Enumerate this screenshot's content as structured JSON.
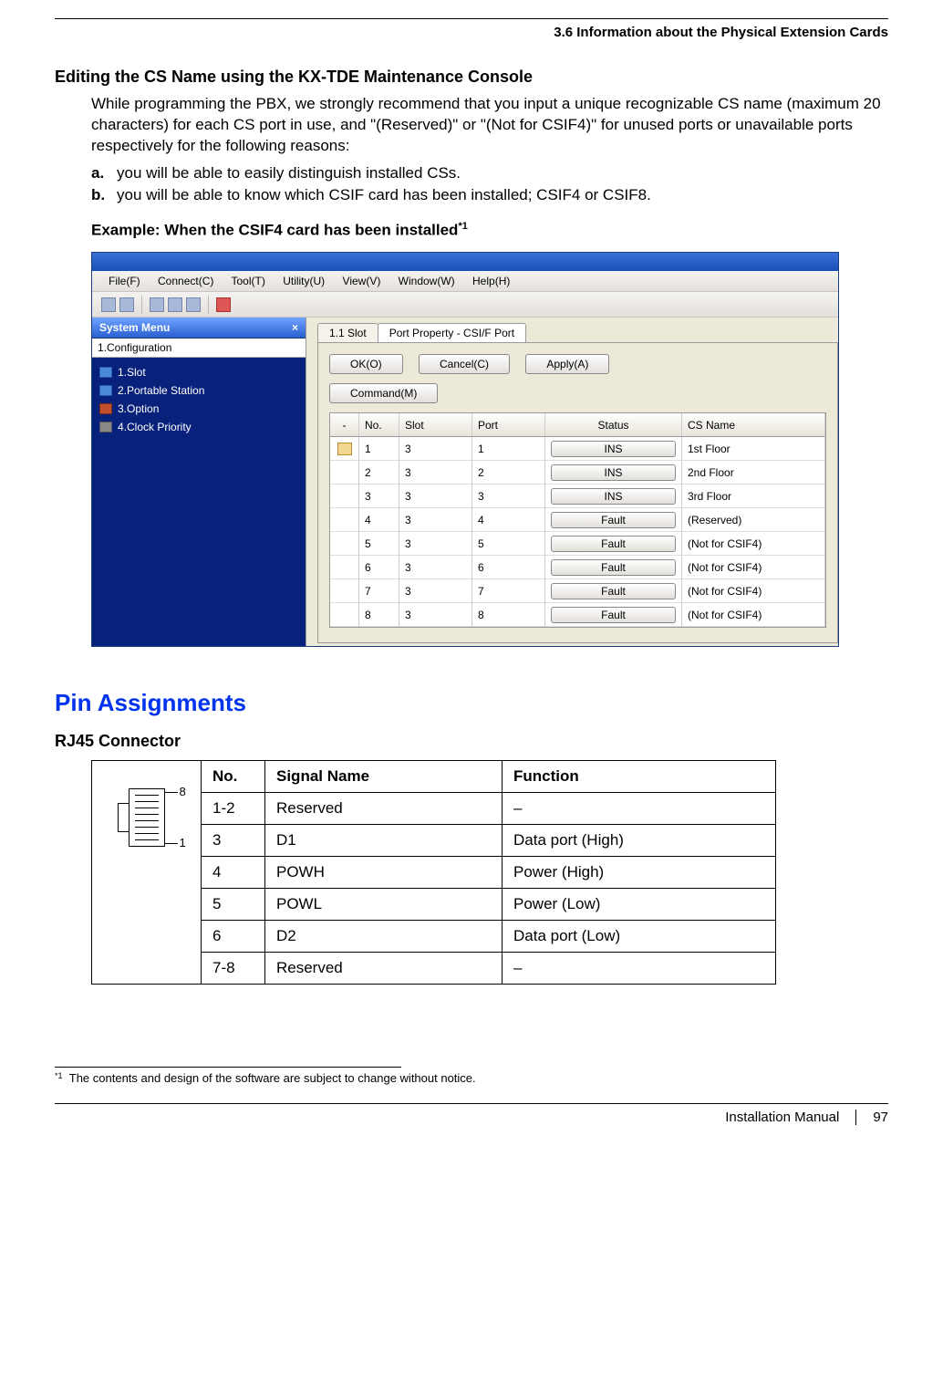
{
  "header": {
    "section": "3.6 Information about the Physical Extension Cards"
  },
  "editing": {
    "title": "Editing the CS Name using the KX-TDE Maintenance Console",
    "paragraph": "While programming the PBX, we strongly recommend that you input a unique recognizable CS name (maximum 20 characters) for each CS port in use, and \"(Reserved)\" or \"(Not for CSIF4)\" for unused ports or unavailable ports respectively for the following reasons:",
    "items": [
      "you will be able to easily distinguish installed CSs.",
      "you will be able to know which CSIF card has been installed; CSIF4 or CSIF8."
    ],
    "example_title": "Example: When the CSIF4 card has been installed",
    "example_sup": "*1"
  },
  "console": {
    "menus": [
      "File(F)",
      "Connect(C)",
      "Tool(T)",
      "Utility(U)",
      "View(V)",
      "Window(W)",
      "Help(H)"
    ],
    "side_title": "System Menu",
    "side_close": "×",
    "side_root": "1.Configuration",
    "tree": [
      {
        "label": "1.Slot",
        "cls": "blue"
      },
      {
        "label": "2.Portable Station",
        "cls": "blue"
      },
      {
        "label": "3.Option",
        "cls": "red"
      },
      {
        "label": "4.Clock Priority",
        "cls": "gray"
      }
    ],
    "tabs": [
      "1.1 Slot",
      "Port Property - CSI/F Port"
    ],
    "buttons": {
      "ok": "OK(O)",
      "cancel": "Cancel(C)",
      "apply": "Apply(A)",
      "command": "Command(M)"
    },
    "columns": {
      "flag": "-",
      "no": "No.",
      "slot": "Slot",
      "port": "Port",
      "status": "Status",
      "csname": "CS Name"
    },
    "rows": [
      {
        "no": "1",
        "slot": "3",
        "port": "1",
        "status": "INS",
        "csname": "1st Floor",
        "flag": true
      },
      {
        "no": "2",
        "slot": "3",
        "port": "2",
        "status": "INS",
        "csname": "2nd Floor"
      },
      {
        "no": "3",
        "slot": "3",
        "port": "3",
        "status": "INS",
        "csname": "3rd Floor"
      },
      {
        "no": "4",
        "slot": "3",
        "port": "4",
        "status": "Fault",
        "csname": "(Reserved)"
      },
      {
        "no": "5",
        "slot": "3",
        "port": "5",
        "status": "Fault",
        "csname": "(Not for CSIF4)"
      },
      {
        "no": "6",
        "slot": "3",
        "port": "6",
        "status": "Fault",
        "csname": "(Not for CSIF4)"
      },
      {
        "no": "7",
        "slot": "3",
        "port": "7",
        "status": "Fault",
        "csname": "(Not for CSIF4)"
      },
      {
        "no": "8",
        "slot": "3",
        "port": "8",
        "status": "Fault",
        "csname": "(Not for CSIF4)"
      }
    ]
  },
  "pin": {
    "heading": "Pin Assignments",
    "sub": "RJ45 Connector",
    "diagram": {
      "top": "8",
      "bottom": "1"
    },
    "columns": {
      "no": "No.",
      "sig": "Signal Name",
      "func": "Function"
    },
    "rows": [
      {
        "no": "1-2",
        "sig": "Reserved",
        "func": "–"
      },
      {
        "no": "3",
        "sig": "D1",
        "func": "Data port (High)"
      },
      {
        "no": "4",
        "sig": "POWH",
        "func": "Power (High)"
      },
      {
        "no": "5",
        "sig": "POWL",
        "func": "Power (Low)"
      },
      {
        "no": "6",
        "sig": "D2",
        "func": "Data port (Low)"
      },
      {
        "no": "7-8",
        "sig": "Reserved",
        "func": "–"
      }
    ]
  },
  "footnote": {
    "marker": "*1",
    "text": "The contents and design of the software are subject to change without notice."
  },
  "footer": {
    "label": "Installation Manual",
    "page": "97"
  }
}
